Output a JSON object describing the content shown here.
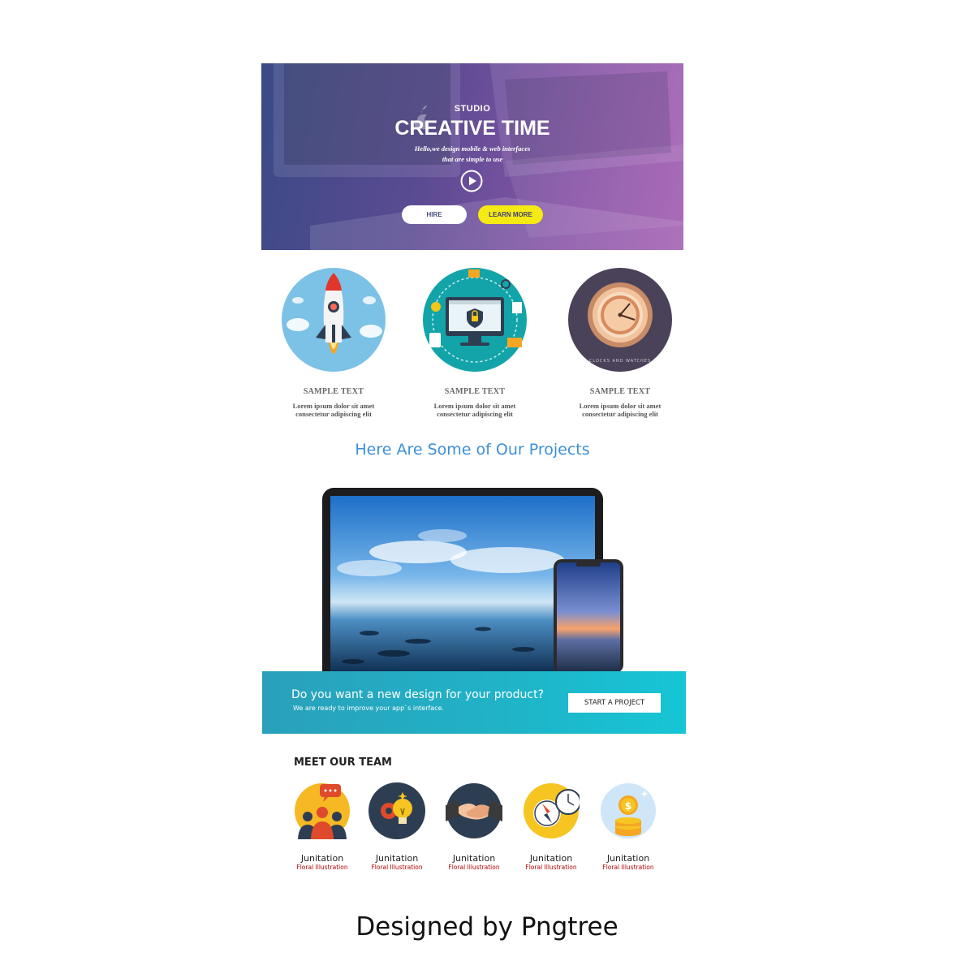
{
  "hero": {
    "eyebrow": "STUDIO",
    "title": "CREATIVE TIME",
    "subtitle_line1": "Hello,we design mobile & web interfaces",
    "subtitle_line2": "that are simple to use",
    "hire_label": "HIRE",
    "learn_more_label": "LEARN MORE",
    "play_icon": "play-icon"
  },
  "features": [
    {
      "title": "SAMPLE TEXT",
      "desc_line1": "Lorem ipsum dolor sit amet",
      "desc_line2": "consectetur adipiscing elit",
      "icon": "rocket-icon"
    },
    {
      "title": "SAMPLE TEXT",
      "desc_line1": "Lorem ipsum dolor sit amet",
      "desc_line2": "consectetur adipiscing elit",
      "icon": "security-monitor-icon"
    },
    {
      "title": "SAMPLE TEXT",
      "desc_line1": "Lorem ipsum dolor sit amet",
      "desc_line2": "consectetur adipiscing elit",
      "icon": "clock-icon",
      "badge_text": "CLOCKS AND WATCHES"
    }
  ],
  "projects": {
    "title": "Here Are Some of Our Projects"
  },
  "cta": {
    "question": "Do you want a new design for your product?",
    "subtext": "We are ready to improve your app`s interface.",
    "button_label": "START A PROJECT"
  },
  "team": {
    "title": "MEET OUR TEAM",
    "members": [
      {
        "name": "Junitation",
        "role": "Floral Illustration",
        "icon": "team-chat-icon"
      },
      {
        "name": "Junitation",
        "role": "Floral Illustration",
        "icon": "idea-gear-icon"
      },
      {
        "name": "Junitation",
        "role": "Floral Illustration",
        "icon": "handshake-icon"
      },
      {
        "name": "Junitation",
        "role": "Floral Illustration",
        "icon": "compass-clock-icon"
      },
      {
        "name": "Junitation",
        "role": "Floral Illustration",
        "icon": "coins-icon"
      }
    ]
  },
  "credit": "Designed by Pngtree",
  "colors": {
    "accent_blue": "#3d8fd6",
    "cta_teal": "#1fb4c8",
    "learn_more_yellow": "#f5ea14",
    "role_red": "#b00000"
  }
}
